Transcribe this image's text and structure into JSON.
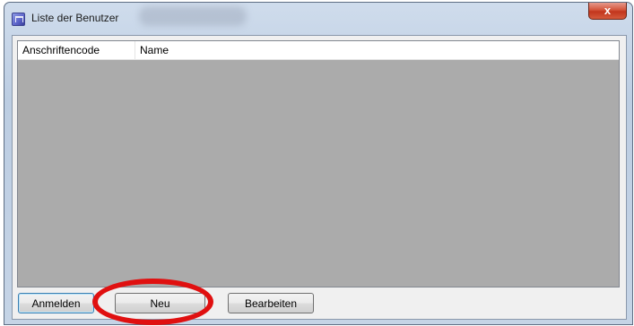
{
  "window": {
    "title": "Liste der Benutzer",
    "close_glyph": "x"
  },
  "list": {
    "columns": [
      "Anschriftencode",
      "Name"
    ],
    "rows": []
  },
  "buttons": {
    "anmelden": "Anmelden",
    "neu": "Neu",
    "bearbeiten": "Bearbeiten"
  },
  "annotation": {
    "highlight_color": "#e01010"
  }
}
